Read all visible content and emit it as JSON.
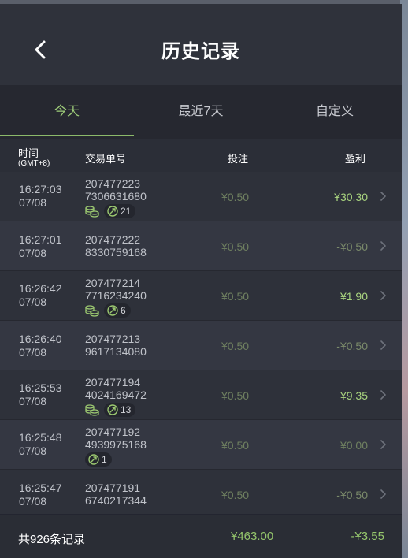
{
  "header": {
    "title": "历史记录"
  },
  "tabs": [
    {
      "label": "今天",
      "active": true
    },
    {
      "label": "最近7天",
      "active": false
    },
    {
      "label": "自定义",
      "active": false
    }
  ],
  "columns": {
    "time": "时间",
    "time_zone": "(GMT+8)",
    "order": "交易单号",
    "bet": "投注",
    "profit": "盈利"
  },
  "rows": [
    {
      "time": "16:27:03",
      "date": "07/08",
      "order_line1": "207477223",
      "order_line2": "7306631680",
      "bet": "¥0.50",
      "profit": "¥30.30",
      "profit_color": "#a9d47f",
      "coins": true,
      "jackpot": "21"
    },
    {
      "time": "16:27:01",
      "date": "07/08",
      "order_line1": "207477222",
      "order_line2": "8330759168",
      "bet": "¥0.50",
      "profit": "-¥0.50",
      "profit_color": "#7a8a6a"
    },
    {
      "time": "16:26:42",
      "date": "07/08",
      "order_line1": "207477214",
      "order_line2": "7716234240",
      "bet": "¥0.50",
      "profit": "¥1.90",
      "profit_color": "#a9d47f",
      "coins": true,
      "jackpot": "6"
    },
    {
      "time": "16:26:40",
      "date": "07/08",
      "order_line1": "207477213",
      "order_line2": "9617134080",
      "bet": "¥0.50",
      "profit": "-¥0.50",
      "profit_color": "#7a8a6a"
    },
    {
      "time": "16:25:53",
      "date": "07/08",
      "order_line1": "207477194",
      "order_line2": "4024169472",
      "bet": "¥0.50",
      "profit": "¥9.35",
      "profit_color": "#a9d47f",
      "coins": true,
      "jackpot": "13"
    },
    {
      "time": "16:25:48",
      "date": "07/08",
      "order_line1": "207477192",
      "order_line2": "4939975168",
      "bet": "¥0.50",
      "profit": "¥0.00",
      "profit_color": "#6f8060",
      "jackpot": "1"
    },
    {
      "time": "16:25:47",
      "date": "07/08",
      "order_line1": "207477191",
      "order_line2": "6740217344",
      "bet": "¥0.50",
      "profit": "-¥0.50",
      "profit_color": "#7a8a6a"
    }
  ],
  "footer": {
    "count": "共926条记录",
    "total_bet": "¥463.00",
    "total_profit": "-¥3.55"
  },
  "icons": {
    "back": "chevron-left-icon",
    "row_chevron": "chevron-right-icon",
    "coins": "coin-stack-icon",
    "jackpot": "swirl-icon"
  },
  "colors": {
    "accent_green": "#9fce7a",
    "panel_bg": "#2b2e37"
  }
}
